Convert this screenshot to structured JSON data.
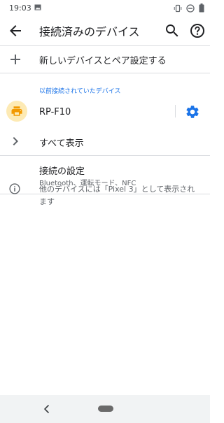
{
  "status_bar": {
    "time": "19:03"
  },
  "app_bar": {
    "title": "接続済みのデバイス"
  },
  "pair_new": {
    "label": "新しいデバイスとペア設定する"
  },
  "previously_connected": {
    "heading": "以前接続されていたデバイス",
    "device_name": "RP-F10"
  },
  "see_all": {
    "label": "すべて表示"
  },
  "connection_prefs": {
    "title": "接続の設定",
    "subtitle": "Bluetooth、運転モード、NFC"
  },
  "footer_info": {
    "text": "他のデバイスには「Pixel 3」として表示されます"
  },
  "colors": {
    "accent": "#1a73e8",
    "printer_bg": "#fdeab4",
    "printer_icon": "#f29900"
  },
  "icons": {
    "back": "arrow-back-icon",
    "search": "search-icon",
    "help": "help-icon",
    "add": "plus-icon",
    "printer": "printer-icon",
    "settings": "gear-icon",
    "expand": "chevron-right-icon",
    "info": "info-icon"
  }
}
